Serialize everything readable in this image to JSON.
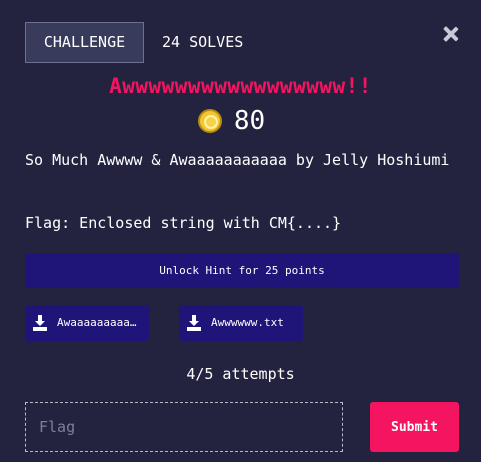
{
  "header": {
    "tab_challenge": "CHALLENGE",
    "tab_solves": "24 SOLVES",
    "close_icon": "close-icon"
  },
  "challenge": {
    "title": "Awwwwwwwwwwwwwwwww!!",
    "points": "80",
    "coin_icon": "coin-icon",
    "description": "So Much Awwww & Awaaaaaaaaaaa by Jelly Hoshiumi",
    "flag_format": "Flag: Enclosed string with CM{....}",
    "hint_label": "Unlock Hint for 25 points",
    "files": [
      {
        "label": "Awaaaaaaaaaaa.txt",
        "icon": "download-icon"
      },
      {
        "label": "Awwwwww.txt",
        "icon": "download-icon"
      }
    ],
    "attempts": "4/5 attempts"
  },
  "form": {
    "flag_placeholder": "Flag",
    "submit_label": "Submit"
  },
  "colors": {
    "background": "#232340",
    "accent": "#f5145f",
    "button": "#1f1478"
  }
}
